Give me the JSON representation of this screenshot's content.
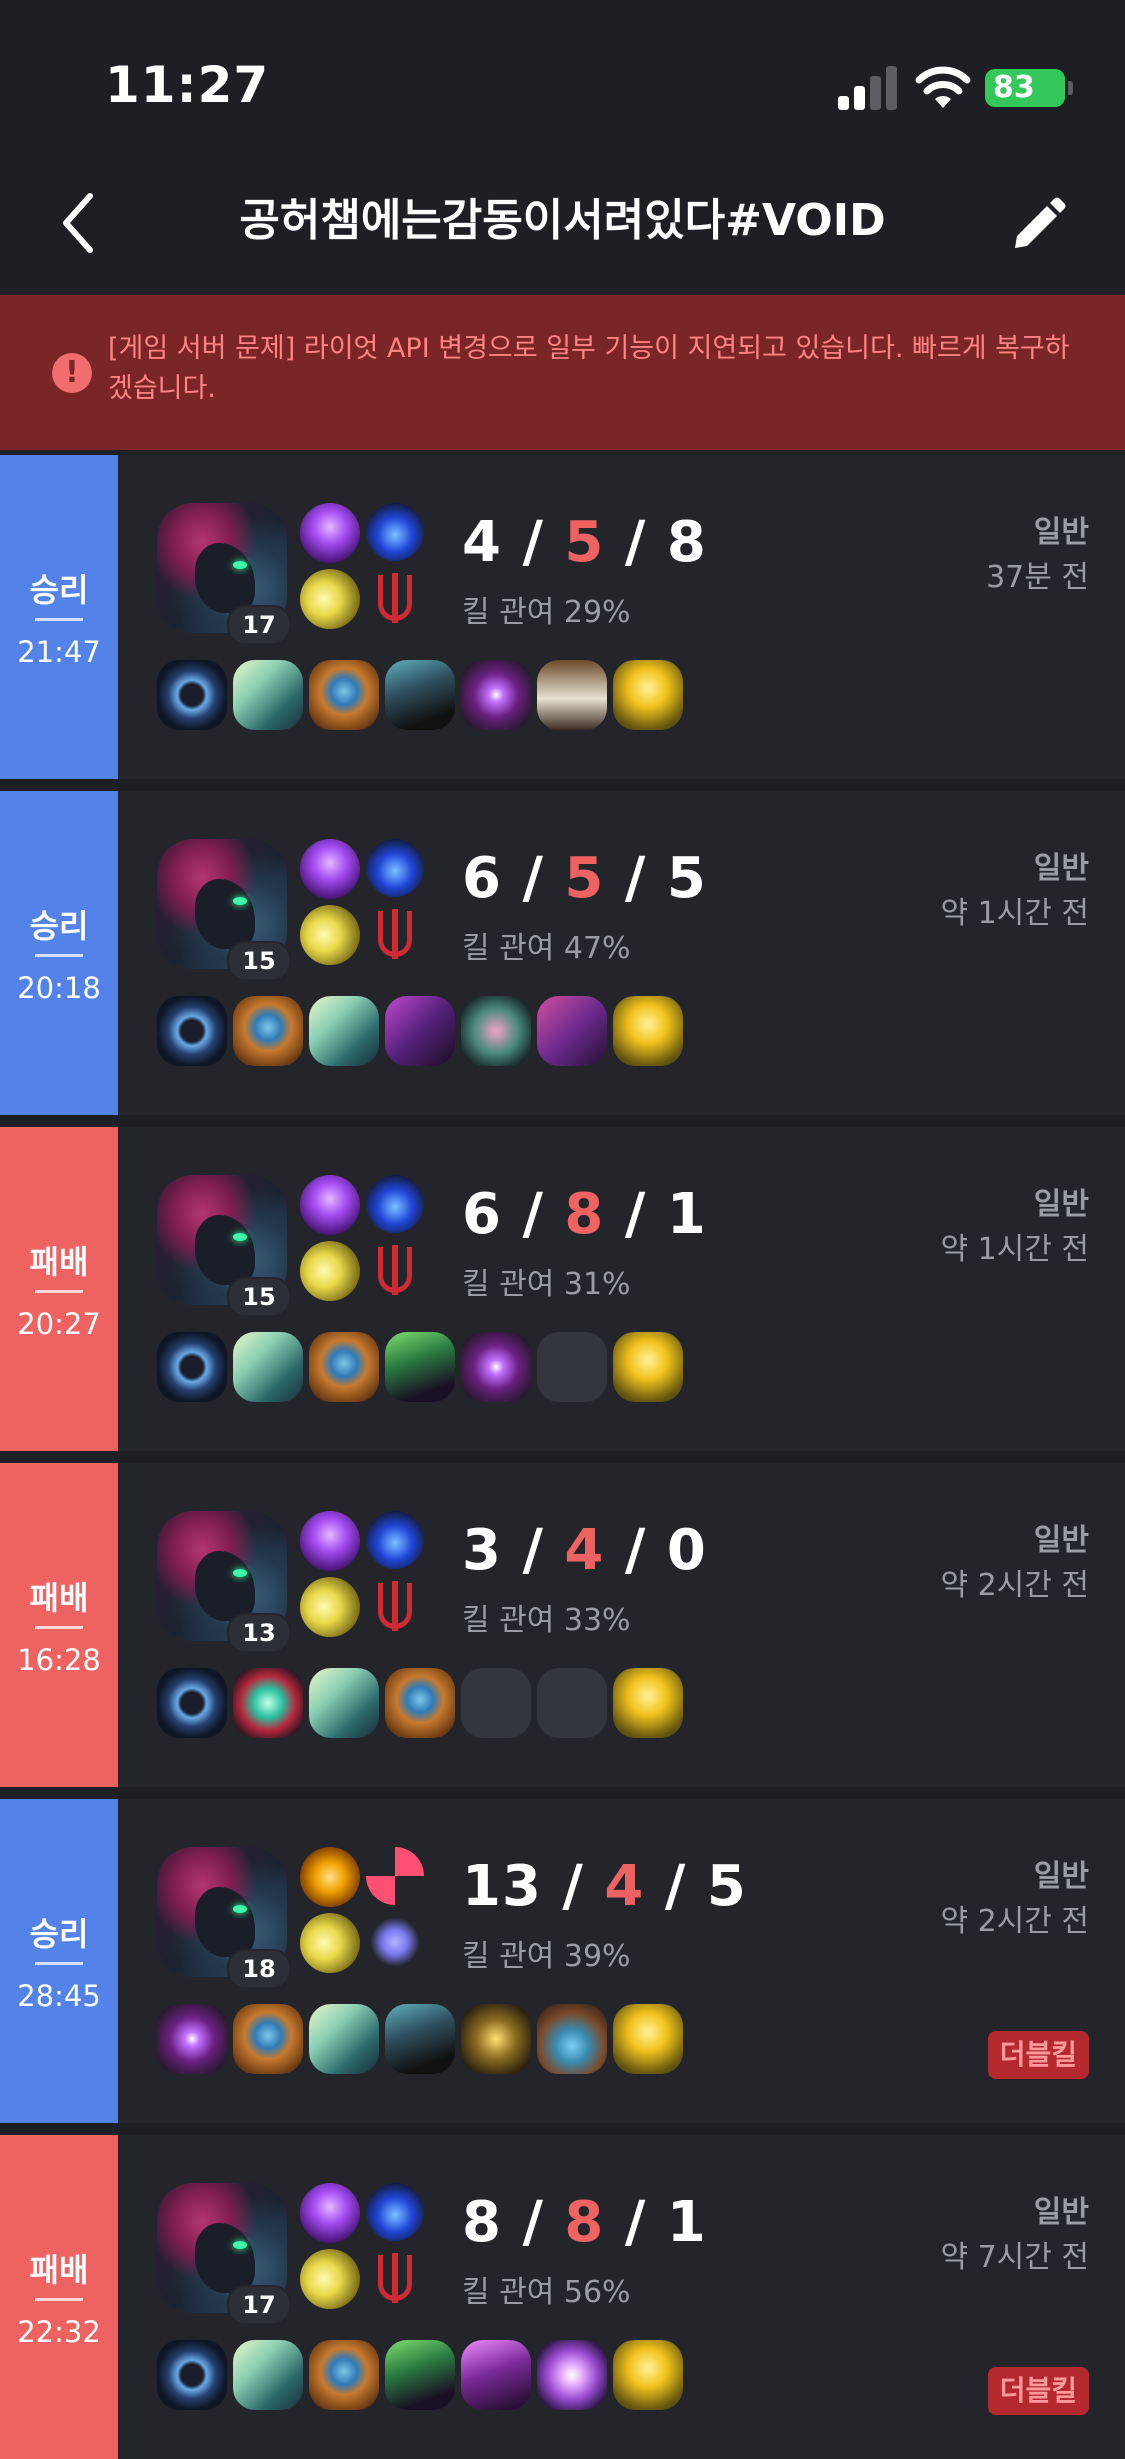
{
  "status_bar": {
    "time": "11:27",
    "battery": "83"
  },
  "header": {
    "title": "공허챔에는감동이서려있다#VOID"
  },
  "banner": {
    "text": "[게임 서버 문제] 라이엇 API 변경으로 일부 기능이 지연되고 있습니다. 빠르게 복구하겠습니다."
  },
  "colors": {
    "win": "#5383e8",
    "loss": "#ef6262",
    "death": "#ef6262",
    "background": "#1d1f24",
    "card": "#23252b",
    "banner": "#7a2526"
  },
  "matches": [
    {
      "result": "승리",
      "outcome": "win",
      "duration": "21:47",
      "level": "17",
      "kills": "4",
      "deaths": "5",
      "assists": "8",
      "kill_participation": "킬 관여 29%",
      "mode": "일반",
      "ago": "37분 전",
      "badge": "",
      "spells": [
        "ghost",
        "flash"
      ],
      "runes": [
        "blue",
        "red"
      ],
      "items": [
        "ring",
        "blade",
        "bag",
        "boot",
        "orb",
        "fist",
        "gold"
      ]
    },
    {
      "result": "승리",
      "outcome": "win",
      "duration": "20:18",
      "level": "15",
      "kills": "6",
      "deaths": "5",
      "assists": "5",
      "kill_participation": "킬 관여 47%",
      "mode": "일반",
      "ago": "약 1시간 전",
      "badge": "",
      "spells": [
        "ghost",
        "flash"
      ],
      "runes": [
        "blue",
        "red"
      ],
      "items": [
        "ring",
        "bag",
        "blade",
        "purple",
        "fox",
        "tome",
        "gold"
      ]
    },
    {
      "result": "패배",
      "outcome": "loss",
      "duration": "20:27",
      "level": "15",
      "kills": "6",
      "deaths": "8",
      "assists": "1",
      "kill_participation": "킬 관여 31%",
      "mode": "일반",
      "ago": "약 1시간 전",
      "badge": "",
      "spells": [
        "ghost",
        "flash"
      ],
      "runes": [
        "blue",
        "red"
      ],
      "items": [
        "ring",
        "blade",
        "bag",
        "green",
        "orb",
        "empty",
        "gold"
      ]
    },
    {
      "result": "패배",
      "outcome": "loss",
      "duration": "16:28",
      "level": "13",
      "kills": "3",
      "deaths": "4",
      "assists": "0",
      "kill_participation": "킬 관여 33%",
      "mode": "일반",
      "ago": "약 2시간 전",
      "badge": "",
      "spells": [
        "ghost",
        "flash"
      ],
      "runes": [
        "blue",
        "red"
      ],
      "items": [
        "ring",
        "crys",
        "blade",
        "bag",
        "empty",
        "empty",
        "gold"
      ]
    },
    {
      "result": "승리",
      "outcome": "win",
      "duration": "28:45",
      "level": "18",
      "kills": "13",
      "deaths": "4",
      "assists": "5",
      "kill_participation": "킬 관여 39%",
      "mode": "일반",
      "ago": "약 2시간 전",
      "badge": "더블킬",
      "spells": [
        "heal",
        "flash"
      ],
      "runes": [
        "pink",
        "lav"
      ],
      "items": [
        "orb",
        "bag",
        "blade",
        "boot",
        "drag",
        "scale",
        "gold"
      ]
    },
    {
      "result": "패배",
      "outcome": "loss",
      "duration": "22:32",
      "level": "17",
      "kills": "8",
      "deaths": "8",
      "assists": "1",
      "kill_participation": "킬 관여 56%",
      "mode": "일반",
      "ago": "약 7시간 전",
      "badge": "더블킬",
      "spells": [
        "ghost",
        "flash"
      ],
      "runes": [
        "blue",
        "red"
      ],
      "items": [
        "ring",
        "blade",
        "bag",
        "green",
        "mask",
        "dspir",
        "gold"
      ]
    }
  ]
}
